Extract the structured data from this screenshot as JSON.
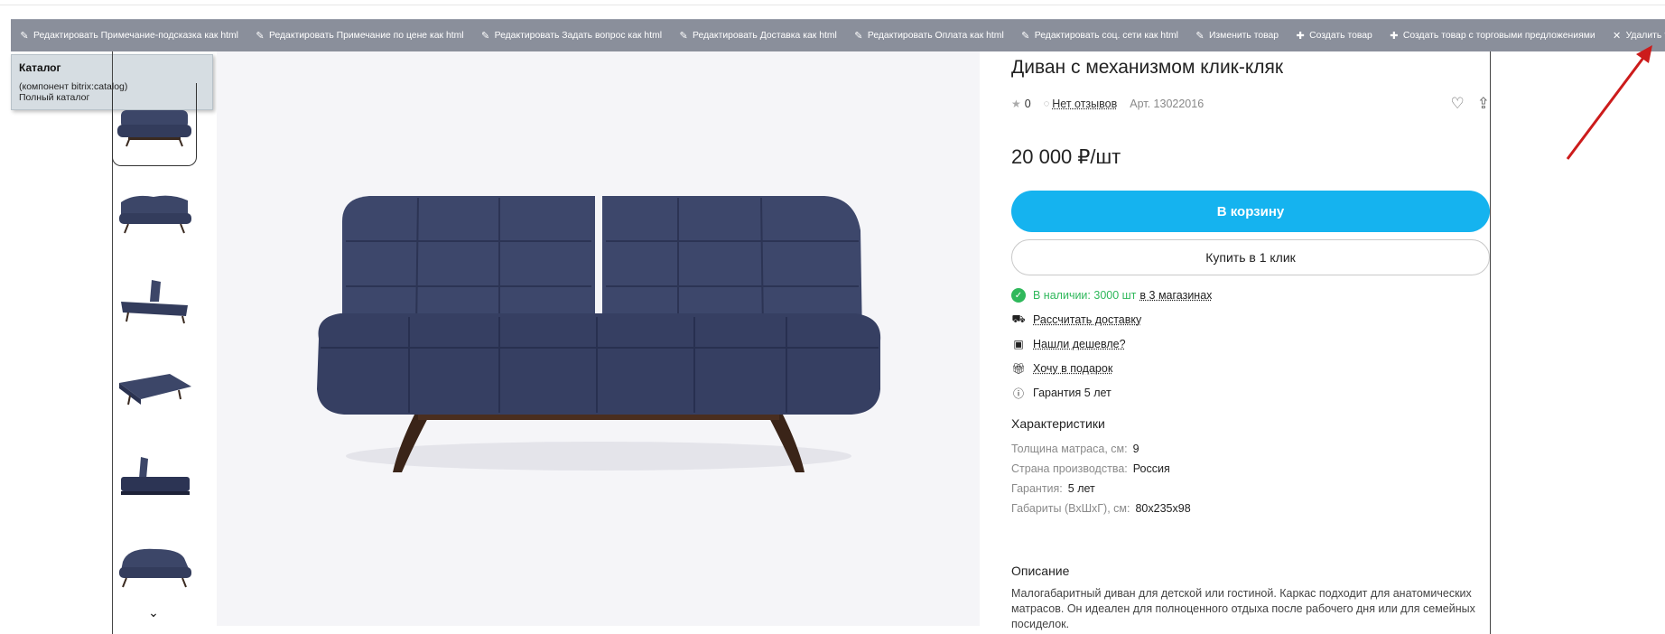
{
  "toolbar": {
    "items": [
      {
        "icon": "pencil-icon",
        "label": "Редактировать Примечание-подсказка как html"
      },
      {
        "icon": "pencil-icon",
        "label": "Редактировать Примечание по цене как html"
      },
      {
        "icon": "pencil-icon",
        "label": "Редактировать Задать вопрос как html"
      },
      {
        "icon": "pencil-icon",
        "label": "Редактировать Доставка как html"
      },
      {
        "icon": "pencil-icon",
        "label": "Редактировать Оплата как html"
      },
      {
        "icon": "pencil-icon",
        "label": "Редактировать соц. сети как html"
      },
      {
        "icon": "pencil-icon",
        "label": "Изменить товар"
      },
      {
        "icon": "plus-icon",
        "label": "Создать товар"
      },
      {
        "icon": "plus-icon",
        "label": "Создать товар с торговыми предложениями"
      },
      {
        "icon": "close-icon",
        "label": "Удалить товар"
      }
    ],
    "pin_icon": "pin-icon",
    "settings_icon": "gear-icon"
  },
  "tooltip": {
    "title": "Каталог",
    "line1": "(компонент bitrix:catalog)",
    "line2": "Полный каталог"
  },
  "product": {
    "title": "Диван с механизмом клик-кляк",
    "rating": "0",
    "reviews": "Нет отзывов",
    "article": "Арт. 13022016",
    "price": "20 000 ₽/шт",
    "add_to_cart": "В корзину",
    "buy_one_click": "Купить в 1 клик",
    "availability": "В наличии: 3000 шт",
    "availability_stores": "в 3 магазинах",
    "delivery": "Рассчитать доставку",
    "cheaper": "Нашли дешевле?",
    "gift": "Хочу в подарок",
    "warranty": "Гарантия 5 лет",
    "specs_title": "Характеристики",
    "specs": [
      {
        "key": "Толщина матраса, см:",
        "value": "9"
      },
      {
        "key": "Страна производства:",
        "value": "Россия"
      },
      {
        "key": "Гарантия:",
        "value": "5 лет"
      },
      {
        "key": "Габариты (ВхШхГ), см:",
        "value": "80x235x98"
      }
    ],
    "description_title": "Описание",
    "description": "Малогабаритный диван для детской или гостиной. Каркас подходит для анатомических матрасов. Он идеален для полноценного отдыха после рабочего дня или для семейных посиделок."
  },
  "colors": {
    "accent": "#15b3ef",
    "in_stock": "#2fb85b",
    "sofa": "#3c4668",
    "toolbar": "#8a8f9b",
    "arrow": "#cc1b1b"
  }
}
